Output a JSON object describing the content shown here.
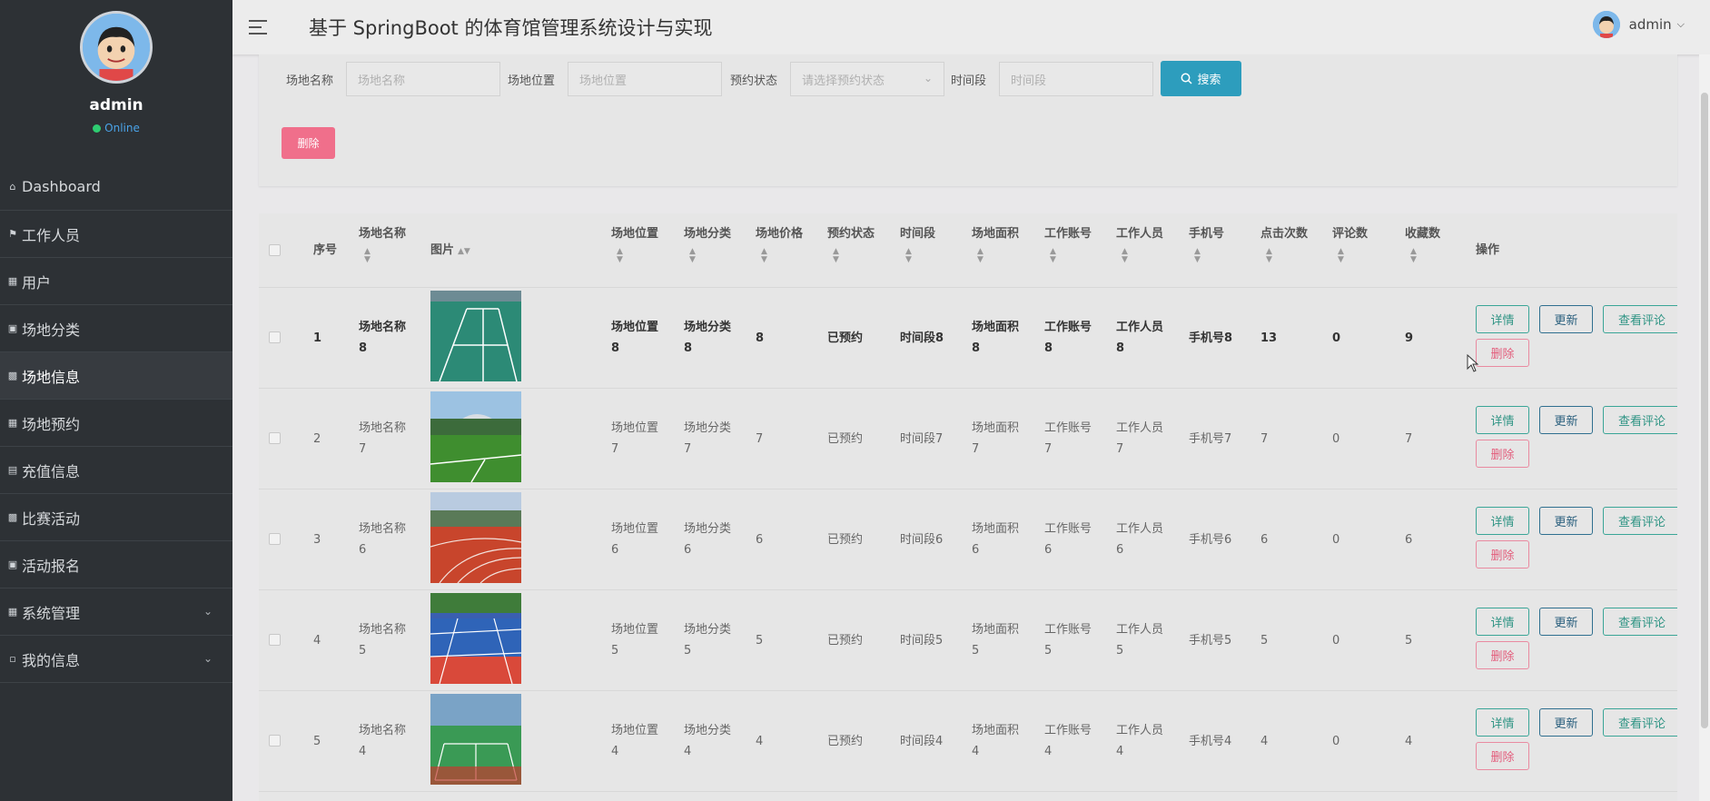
{
  "sidebar": {
    "username": "admin",
    "status": "Online",
    "items": [
      {
        "label": "Dashboard",
        "icon": "home-icon"
      },
      {
        "label": "工作人员",
        "icon": "flag-icon"
      },
      {
        "label": "用户",
        "icon": "grid-icon"
      },
      {
        "label": "场地分类",
        "icon": "briefcase-icon"
      },
      {
        "label": "场地信息",
        "icon": "clipboard-icon",
        "active": true
      },
      {
        "label": "场地预约",
        "icon": "grid-icon"
      },
      {
        "label": "充值信息",
        "icon": "document-icon"
      },
      {
        "label": "比赛活动",
        "icon": "bar-chart-icon"
      },
      {
        "label": "活动报名",
        "icon": "thumbs-up-icon"
      },
      {
        "label": "系统管理",
        "icon": "grid-icon",
        "expandable": true
      },
      {
        "label": "我的信息",
        "icon": "id-card-icon",
        "expandable": true
      }
    ]
  },
  "header": {
    "title": "基于 SpringBoot 的体育馆管理系统设计与实现",
    "user": "admin"
  },
  "search": {
    "fields": [
      {
        "label": "场地名称",
        "placeholder": "场地名称"
      },
      {
        "label": "场地位置",
        "placeholder": "场地位置"
      },
      {
        "label": "预约状态",
        "placeholder": "请选择预约状态"
      },
      {
        "label": "时间段",
        "placeholder": "时间段"
      }
    ],
    "search_button": "搜索",
    "delete_button": "删除"
  },
  "table": {
    "columns": [
      "序号",
      "场地名称",
      "图片",
      "场地位置",
      "场地分类",
      "场地价格",
      "预约状态",
      "时间段",
      "场地面积",
      "工作账号",
      "工作人员",
      "手机号",
      "点击次数",
      "评论数",
      "收藏数",
      "操作"
    ],
    "actions": {
      "detail": "详情",
      "update": "更新",
      "review": "查看评论",
      "delete": "删除"
    },
    "rows": [
      {
        "idx": "1",
        "name": [
          "场地名称",
          "8"
        ],
        "location": [
          "场地位置",
          "8"
        ],
        "category": [
          "场地分类",
          "8"
        ],
        "price": "8",
        "status": "已预约",
        "slot": "时间段8",
        "area": [
          "场地面积",
          "8"
        ],
        "account": [
          "工作账号",
          "8"
        ],
        "staff": [
          "工作人员",
          "8"
        ],
        "phone": "手机号8",
        "clicks": "13",
        "comments": "0",
        "favorites": "9",
        "image": "badminton-indoor-green"
      },
      {
        "idx": "2",
        "name": [
          "场地名称",
          "7"
        ],
        "location": [
          "场地位置",
          "7"
        ],
        "category": [
          "场地分类",
          "7"
        ],
        "price": "7",
        "status": "已预约",
        "slot": "时间段7",
        "area": [
          "场地面积",
          "7"
        ],
        "account": [
          "工作账号",
          "7"
        ],
        "staff": [
          "工作人员",
          "7"
        ],
        "phone": "手机号7",
        "clicks": "7",
        "comments": "0",
        "favorites": "7",
        "image": "football-field"
      },
      {
        "idx": "3",
        "name": [
          "场地名称",
          "6"
        ],
        "location": [
          "场地位置",
          "6"
        ],
        "category": [
          "场地分类",
          "6"
        ],
        "price": "6",
        "status": "已预约",
        "slot": "时间段6",
        "area": [
          "场地面积",
          "6"
        ],
        "account": [
          "工作账号",
          "6"
        ],
        "staff": [
          "工作人员",
          "6"
        ],
        "phone": "手机号6",
        "clicks": "6",
        "comments": "0",
        "favorites": "6",
        "image": "running-track"
      },
      {
        "idx": "4",
        "name": [
          "场地名称",
          "5"
        ],
        "location": [
          "场地位置",
          "5"
        ],
        "category": [
          "场地分类",
          "5"
        ],
        "price": "5",
        "status": "已预约",
        "slot": "时间段5",
        "area": [
          "场地面积",
          "5"
        ],
        "account": [
          "工作账号",
          "5"
        ],
        "staff": [
          "工作人员",
          "5"
        ],
        "phone": "手机号5",
        "clicks": "5",
        "comments": "0",
        "favorites": "5",
        "image": "outdoor-court-blue"
      },
      {
        "idx": "5",
        "name": [
          "场地名称",
          "4"
        ],
        "location": [
          "场地位置",
          "4"
        ],
        "category": [
          "场地分类",
          "4"
        ],
        "price": "4",
        "status": "已预约",
        "slot": "时间段4",
        "area": [
          "场地面积",
          "4"
        ],
        "account": [
          "工作账号",
          "4"
        ],
        "staff": [
          "工作人员",
          "4"
        ],
        "phone": "手机号4",
        "clicks": "4",
        "comments": "0",
        "favorites": "4",
        "image": "badminton-hall"
      }
    ]
  },
  "colors": {
    "sidebar_bg": "#2d3135",
    "search_button": "#2d9dbd",
    "delete_button": "#f06f8b",
    "teal": "#3aa597",
    "navy": "#2f6f8f",
    "pink": "#e35d7c"
  }
}
